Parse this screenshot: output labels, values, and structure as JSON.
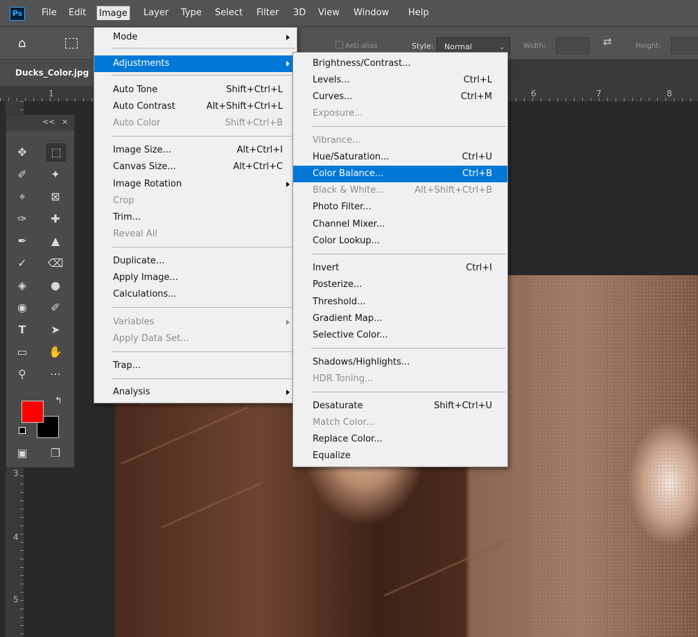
{
  "app": {
    "logo_text": "Ps"
  },
  "menubar": {
    "items": [
      "File",
      "Edit",
      "Image",
      "Layer",
      "Type",
      "Select",
      "Filter",
      "3D",
      "View",
      "Window",
      "Help"
    ],
    "active": "Image"
  },
  "options_bar": {
    "anti_alias_label": "Anti-alias",
    "style_label": "Style:",
    "style_value": "Normal",
    "width_label": "Width:",
    "height_label": "Height:"
  },
  "document": {
    "tab_title": "Ducks_Color.jpg"
  },
  "rulers": {
    "top_numbers": [
      "1",
      "6",
      "7",
      "8"
    ],
    "left_numbers": [
      "3",
      "4",
      "5"
    ]
  },
  "toolbox": {
    "collapse_glyph": "<<",
    "close_glyph": "×",
    "foreground_color": "#ff0000",
    "background_color": "#000000"
  },
  "image_menu": {
    "items": [
      {
        "label": "Mode",
        "submenu": true
      },
      {
        "label": "Adjustments",
        "submenu": true,
        "highlighted": true
      },
      {
        "label": "Auto Tone",
        "shortcut": "Shift+Ctrl+L"
      },
      {
        "label": "Auto Contrast",
        "shortcut": "Alt+Shift+Ctrl+L"
      },
      {
        "label": "Auto Color",
        "shortcut": "Shift+Ctrl+B",
        "disabled": true
      },
      {
        "label": "Image Size...",
        "shortcut": "Alt+Ctrl+I"
      },
      {
        "label": "Canvas Size...",
        "shortcut": "Alt+Ctrl+C"
      },
      {
        "label": "Image Rotation",
        "submenu": true
      },
      {
        "label": "Crop",
        "disabled": true
      },
      {
        "label": "Trim..."
      },
      {
        "label": "Reveal All",
        "disabled": true
      },
      {
        "label": "Duplicate..."
      },
      {
        "label": "Apply Image..."
      },
      {
        "label": "Calculations..."
      },
      {
        "label": "Variables",
        "submenu": true,
        "disabled": true
      },
      {
        "label": "Apply Data Set...",
        "disabled": true
      },
      {
        "label": "Trap..."
      },
      {
        "label": "Analysis",
        "submenu": true
      }
    ]
  },
  "adjustments_menu": {
    "items": [
      {
        "label": "Brightness/Contrast..."
      },
      {
        "label": "Levels...",
        "shortcut": "Ctrl+L"
      },
      {
        "label": "Curves...",
        "shortcut": "Ctrl+M"
      },
      {
        "label": "Exposure...",
        "disabled": true
      },
      {
        "label": "Vibrance...",
        "disabled": true
      },
      {
        "label": "Hue/Saturation...",
        "shortcut": "Ctrl+U"
      },
      {
        "label": "Color Balance...",
        "shortcut": "Ctrl+B",
        "highlighted": true
      },
      {
        "label": "Black & White...",
        "shortcut": "Alt+Shift+Ctrl+B",
        "disabled": true
      },
      {
        "label": "Photo Filter..."
      },
      {
        "label": "Channel Mixer..."
      },
      {
        "label": "Color Lookup..."
      },
      {
        "label": "Invert",
        "shortcut": "Ctrl+I"
      },
      {
        "label": "Posterize..."
      },
      {
        "label": "Threshold..."
      },
      {
        "label": "Gradient Map..."
      },
      {
        "label": "Selective Color..."
      },
      {
        "label": "Shadows/Highlights..."
      },
      {
        "label": "HDR Toning...",
        "disabled": true
      },
      {
        "label": "Desaturate",
        "shortcut": "Shift+Ctrl+U"
      },
      {
        "label": "Match Color...",
        "disabled": true
      },
      {
        "label": "Replace Color..."
      },
      {
        "label": "Equalize"
      }
    ]
  }
}
